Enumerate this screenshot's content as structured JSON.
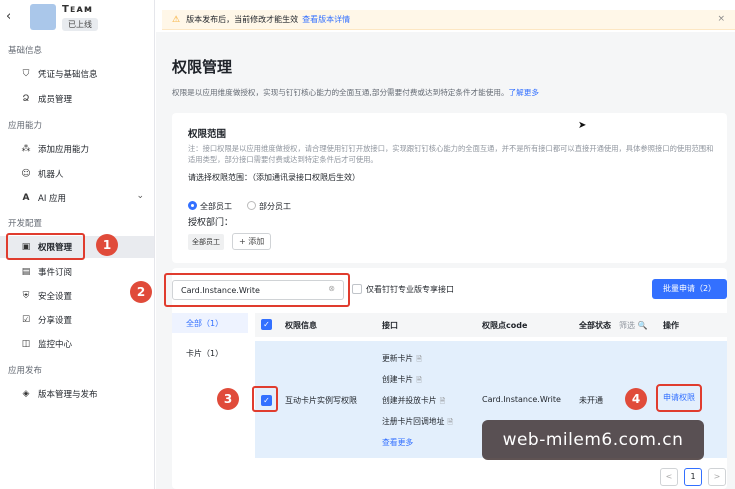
{
  "sidebar": {
    "back_icon": "‹",
    "app_name": "Tᴇᴀᴍ​",
    "status": "已上线",
    "groups": {
      "basic": "基础信息",
      "ability": "应用能力",
      "dev": "开发配置",
      "release": "应用发布"
    },
    "items": {
      "credentials": "凭证与基础信息",
      "members": "成员管理",
      "add_ability": "添加应用能力",
      "robot": "机器人",
      "ai_app": "AI 应用",
      "permission": "权限管理",
      "events": "事件订阅",
      "security": "安全设置",
      "share": "分享设置",
      "monitor": "监控中心",
      "version": "版本管理与发布"
    }
  },
  "banner": {
    "text": "版本发布后，当前修改才能生效",
    "link": "查看版本详情",
    "close": "×"
  },
  "page": {
    "title": "权限管理",
    "desc": "权限是以应用维度做授权，实现与钉钉核心能力的全面互通,部分需要付费或达到特定条件才能使用。",
    "learn_more": "了解更多"
  },
  "scope": {
    "title": "权限范围",
    "note": "注：接口权限是以应用维度做授权，请合理使用钉钉开放接口，实现跟钉钉核心能力的全面互通，并不是所有接口都可以直接开通使用，具体参照接口的使用范围和适用类型，部分接口需要付费或达到特定条件后才可使用。",
    "select_label": "请选择权限范围：（添加通讯录接口权限后生效）",
    "radio_all": "全部员工",
    "radio_part": "部分员工",
    "dept_label": "授权部门：",
    "dept_tag": "全部员工",
    "add_button": "+ 添加"
  },
  "toolbar": {
    "search_value": "Card.Instance.Write",
    "clear": "⊗",
    "pro_only": "仅看钉钉专业版专享接口",
    "batch_button": "批量申请（2）"
  },
  "categories": {
    "all": "全部（1）",
    "card": "卡片（1）"
  },
  "table": {
    "headers": {
      "info": "权限信息",
      "api": "接口",
      "code": "权限点code",
      "status": "全部状态",
      "filter": "筛选 🔍",
      "action": "操作"
    },
    "row": {
      "name": "互动卡片实例写权限",
      "apis": [
        "更新卡片",
        "创建卡片",
        "创建并投放卡片",
        "注册卡片回调地址"
      ],
      "more": "查看更多",
      "code": "Card.Instance.Write",
      "status": "未开通",
      "action": "申请权限"
    }
  },
  "badges": [
    "1",
    "2",
    "3",
    "4"
  ],
  "watermark": "web-milem6.com.cn",
  "pager": {
    "prev": "<",
    "page": "1",
    "next": ">"
  },
  "accent_color": "#3370ff",
  "highlight_color": "#e03c2e"
}
